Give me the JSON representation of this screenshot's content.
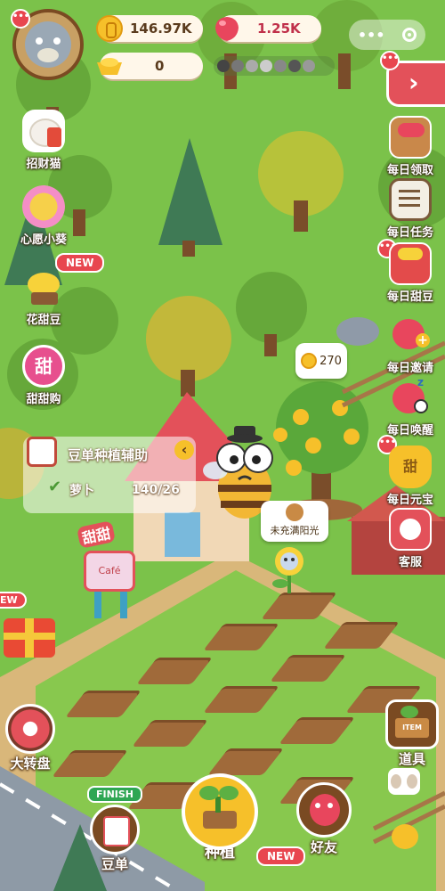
{
  "resources": {
    "coins": "146.97K",
    "gems": "1.25K",
    "ingots": "0"
  },
  "side_left": [
    {
      "label": "招财猫",
      "icon": "lucky-cat-icon"
    },
    {
      "label": "心愿小葵",
      "icon": "sunflower-icon"
    },
    {
      "label": "花甜豆",
      "icon": "sweet-bean-icon",
      "badge": "NEW"
    },
    {
      "label": "甜甜购",
      "icon": "sweet-shop-icon",
      "glyph": "甜"
    }
  ],
  "side_right": [
    {
      "label": "每日领取",
      "icon": "daily-gift-basket-icon"
    },
    {
      "label": "每日任务",
      "icon": "daily-task-clipboard-icon"
    },
    {
      "label": "每日甜豆",
      "icon": "daily-bean-basket-icon"
    },
    {
      "label": "每日邀请",
      "icon": "daily-invite-icon"
    },
    {
      "label": "每日唤醒",
      "icon": "daily-wakeup-icon"
    },
    {
      "label": "每日元宝",
      "icon": "daily-ingot-icon",
      "glyph": "甜"
    },
    {
      "label": "客服",
      "icon": "customer-service-phone-icon"
    }
  ],
  "order_panel": {
    "title": "豆单种植辅助",
    "crop": "萝卜",
    "progress": "140/26"
  },
  "speech": {
    "coin_bubble": "270",
    "sun_status": "未充满阳光"
  },
  "signs": {
    "tiantian_sign": "甜甜",
    "cafe_sign": "Café"
  },
  "badges": {
    "new_left_gift": "EW",
    "finish": "FINISH",
    "new_friends": "NEW"
  },
  "bottom": {
    "wheel": "大转盘",
    "orders": "豆单",
    "plant": "种植",
    "friends": "好友",
    "tools": "道具",
    "tools_box_text": "ITEM"
  },
  "colors": {
    "grass": "#7bc24a",
    "soil": "#a06a3a",
    "accent_red": "#e8464f",
    "coin": "#f6c02a"
  }
}
